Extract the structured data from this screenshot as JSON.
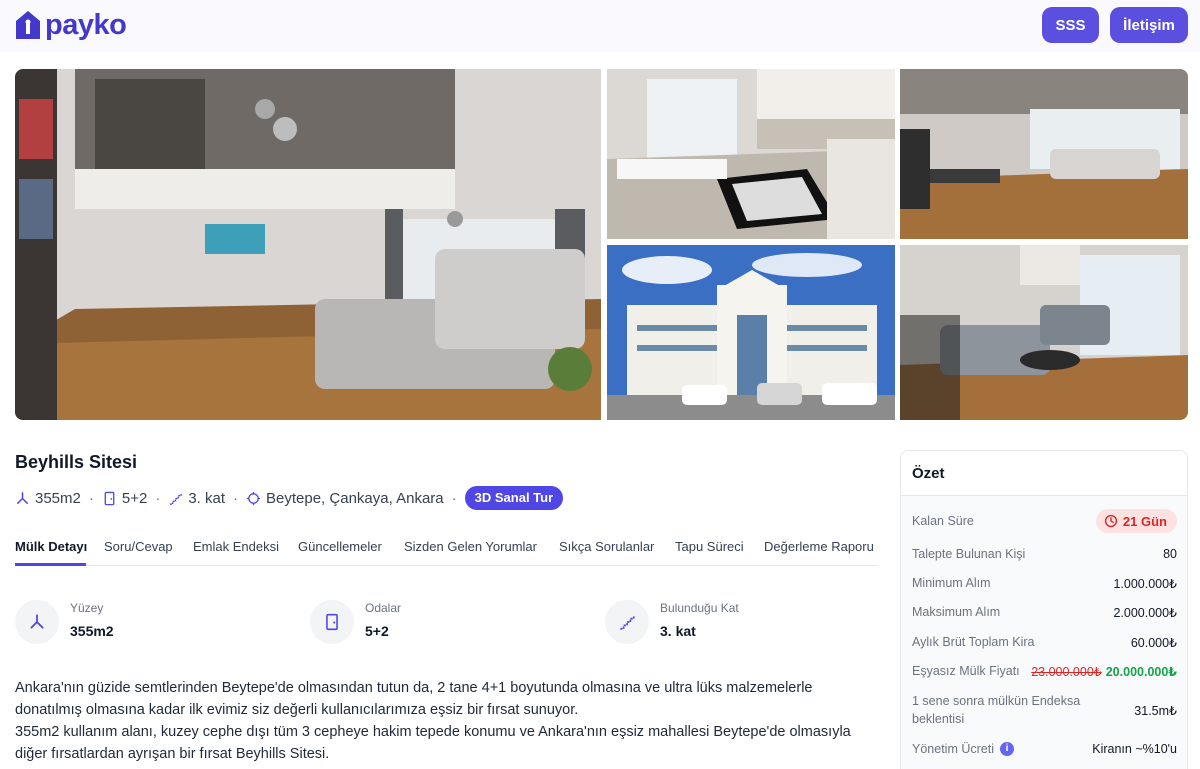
{
  "header": {
    "logo_text": "payko",
    "sss_label": "SSS",
    "contact_label": "İletişim"
  },
  "gallery": {
    "photos": [
      "living-room-photo",
      "kitchen-photo",
      "dining-area-photo",
      "building-exterior-photo",
      "balcony-lounge-photo"
    ]
  },
  "property": {
    "title": "Beyhills Sitesi",
    "area": "355m2",
    "rooms": "5+2",
    "floor": "3. kat",
    "location": "Beytepe, Çankaya, Ankara",
    "tour_label": "3D Sanal Tur"
  },
  "tabs": [
    {
      "label": "Mülk Detayı",
      "active": true
    },
    {
      "label": "Soru/Cevap"
    },
    {
      "label": "Emlak Endeksi"
    },
    {
      "label": "Güncellemeler"
    },
    {
      "label": "Sizden Gelen Yorumlar"
    },
    {
      "label": "Sıkça Sorulanlar"
    },
    {
      "label": "Tapu Süreci"
    },
    {
      "label": "Değerleme Raporu"
    }
  ],
  "stats": [
    {
      "label": "Yüzey",
      "value": "355m2",
      "icon": "area-icon"
    },
    {
      "label": "Odalar",
      "value": "5+2",
      "icon": "door-icon"
    },
    {
      "label": "Bulunduğu Kat",
      "value": "3. kat",
      "icon": "stairs-icon"
    }
  ],
  "description": {
    "line1": "Ankara'nın güzide semtlerinden Beytepe'de olmasından tutun da, 2 tane 4+1 boyutunda olmasına ve ultra lüks malzemelerle",
    "line2": "donatılmış olmasına kadar ilk evimiz siz değerli kullanıcılarımıza eşsiz bir fırsat sunuyor.",
    "line3": "355m2 kullanım alanı, kuzey cephe dışı tüm 3 cepheye hakim tepede konumu ve Ankara'nın eşsiz mahallesi Beytepe'de olmasıyla",
    "line4": "diğer fırsatlardan ayrışan bir fırsat Beyhills Sitesi."
  },
  "summary": {
    "title": "Özet",
    "remaining_label": "Kalan Süre",
    "remaining_value": "21 Gün",
    "demand_label": "Talepte Bulunan Kişi",
    "demand_value": "80",
    "min_label": "Minimum Alım",
    "min_value": "1.000.000₺",
    "max_label": "Maksimum Alım",
    "max_value": "2.000.000₺",
    "rent_label": "Aylık Brüt Toplam Kira",
    "rent_value": "60.000₺",
    "price_label": "Eşyasız Mülk Fiyatı",
    "price_old": "23.000.000₺",
    "price_new": "20.000.000₺",
    "index_label_1": "1 sene sonra mülkün Endeksa",
    "index_label_2": "beklentisi",
    "index_value": "31.5m₺",
    "fee_label": "Yönetim Ücreti",
    "fee_info": "i",
    "fee_value": "Kiranın ~%10'u"
  },
  "colors": {
    "brand": "#4f46e5",
    "danger": "#dc2626",
    "success": "#16a34a"
  }
}
